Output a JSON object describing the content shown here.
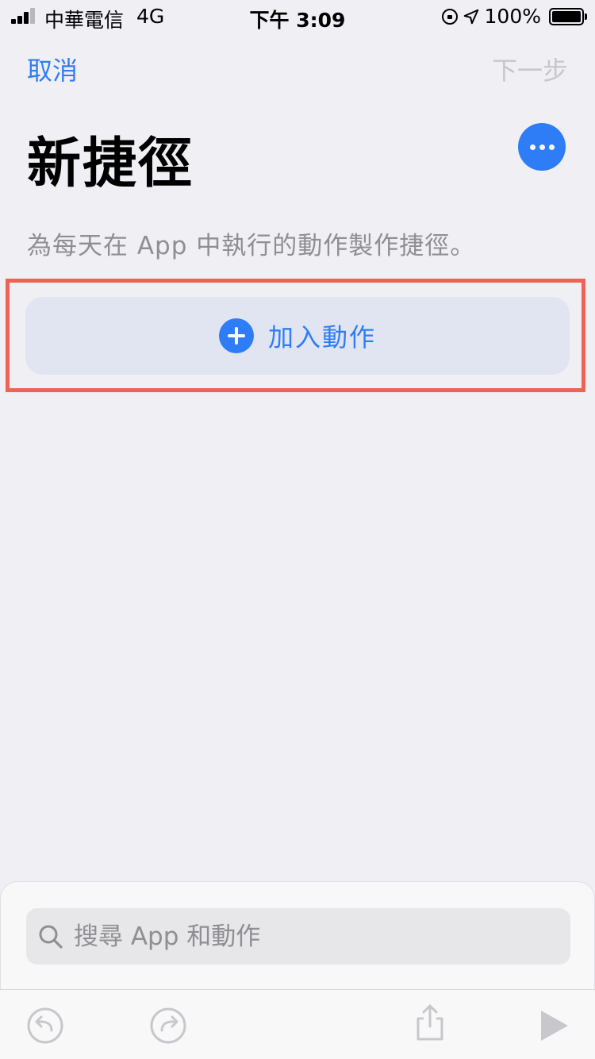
{
  "status_bar": {
    "carrier": "中華電信",
    "network": "4G",
    "time": "下午 3:09",
    "battery": "100%",
    "battery_level": 1.0
  },
  "nav": {
    "cancel_label": "取消",
    "next_label": "下一步"
  },
  "header": {
    "title": "新捷徑",
    "more_icon": "ellipsis-icon"
  },
  "subtitle": "為每天在 App 中執行的動作製作捷徑。",
  "add_action": {
    "label": "加入動作",
    "icon": "plus-circle-icon"
  },
  "search": {
    "placeholder": "搜尋 App 和動作",
    "value": ""
  },
  "toolbar": {
    "items": [
      "undo-icon",
      "redo-icon",
      "share-icon",
      "play-icon"
    ]
  },
  "colors": {
    "accent": "#2f7df6",
    "disabled": "#c7c7cc",
    "highlight": "#ee6355",
    "background": "#efeff4"
  }
}
